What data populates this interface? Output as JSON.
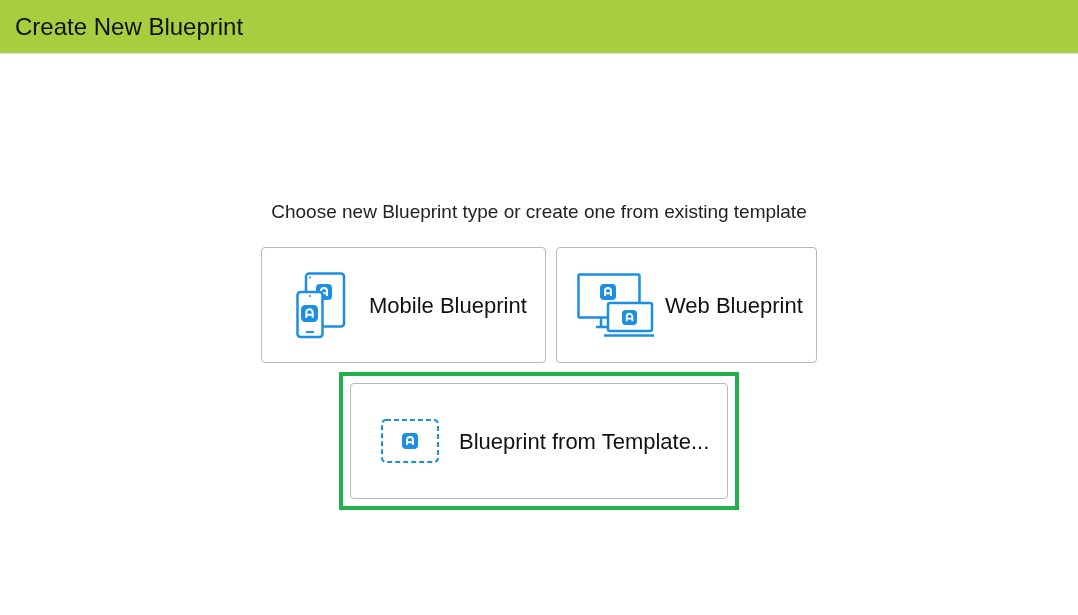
{
  "header": {
    "title": "Create New Blueprint"
  },
  "prompt": "Choose new Blueprint type or create one from existing template",
  "options": [
    {
      "kind": "mobile",
      "label": "Mobile Blueprint",
      "selected": false
    },
    {
      "kind": "web",
      "label": "Web Blueprint",
      "selected": false
    },
    {
      "kind": "template",
      "label": "Blueprint from Template...",
      "selected": true
    }
  ]
}
